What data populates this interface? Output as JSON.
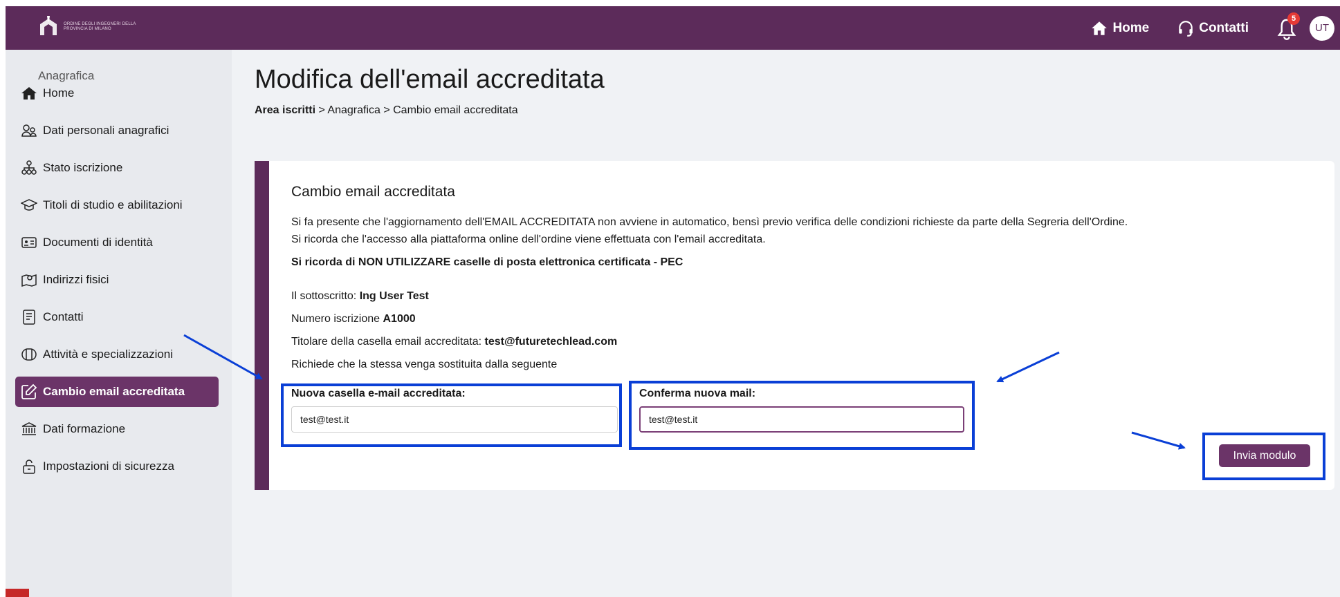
{
  "header": {
    "logo_text": "Ordine degli Ingegneri della Provincia di Milano",
    "nav_home": "Home",
    "nav_contacts": "Contatti",
    "notifications_count": "5",
    "avatar_initials": "UT"
  },
  "sidebar": {
    "title": "Anagrafica",
    "items": [
      {
        "label": "Home",
        "icon": "house-icon"
      },
      {
        "label": "Dati personali anagrafici",
        "icon": "users-icon"
      },
      {
        "label": "Stato iscrizione",
        "icon": "org-chart-icon"
      },
      {
        "label": "Titoli di studio e abilitazioni",
        "icon": "graduation-cap-icon"
      },
      {
        "label": "Documenti di identità",
        "icon": "id-card-icon"
      },
      {
        "label": "Indirizzi fisici",
        "icon": "map-pin-icon"
      },
      {
        "label": "Contatti",
        "icon": "document-icon"
      },
      {
        "label": "Attività e specializzazioni",
        "icon": "briefcase-icon"
      },
      {
        "label": "Cambio email accreditata",
        "icon": "edit-icon"
      },
      {
        "label": "Dati formazione",
        "icon": "institution-icon"
      },
      {
        "label": "Impostazioni di sicurezza",
        "icon": "unlock-icon"
      }
    ],
    "active_index": 8
  },
  "page": {
    "title": "Modifica dell'email accreditata",
    "breadcrumb_root": "Area iscritti",
    "breadcrumb_rest": " > Anagrafica > Cambio email accreditata"
  },
  "card": {
    "title": "Cambio email accreditata",
    "note1": "Si fa presente che l'aggiornamento dell'EMAIL ACCREDITATA non avviene in automatico, bensì previo verifica delle condizioni richieste da parte della Segreria dell'Ordine.",
    "note2": "Si ricorda che l'accesso alla piattaforma online dell'ordine viene effettuata con l'email accreditata.",
    "warning": "Si ricorda di NON UTILIZZARE caselle di posta elettronica certificata - PEC",
    "undersigned_label": "Il sottoscritto: ",
    "undersigned_value": "Ing User Test",
    "registration_label": "Numero iscrizione ",
    "registration_value": "A1000",
    "holder_label": "Titolare della casella email accreditata: ",
    "holder_value": "test@futuretechlead.com",
    "request_text": "Richiede che la stessa venga sostituita dalla seguente",
    "new_email_label": "Nuova casella e-mail accreditata:",
    "new_email_value": "test@test.it",
    "confirm_email_label": "Conferma nuova mail:",
    "confirm_email_value": "test@test.it",
    "submit_label": "Invia modulo"
  },
  "colors": {
    "brand": "#5c2b5a",
    "active": "#6b3468",
    "annotation": "#0a3fd6",
    "badge": "#e53935"
  }
}
